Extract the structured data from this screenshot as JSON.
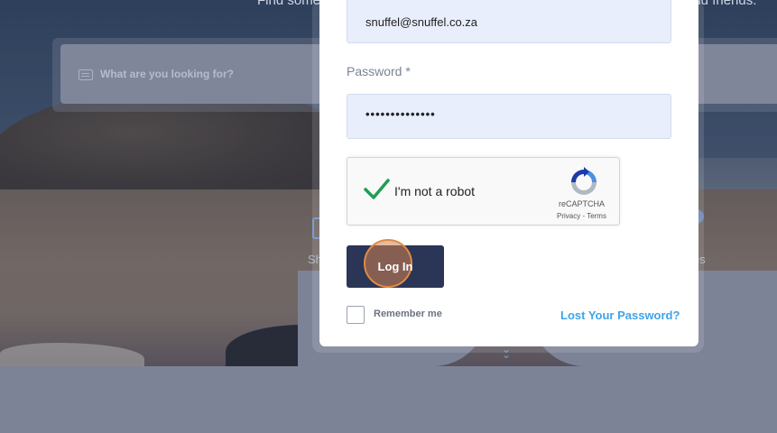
{
  "background": {
    "hero_text_left": "Find some",
    "hero_text_right": "and friends.",
    "search_placeholder": "What are you looking for?",
    "category_left": "Sh",
    "category_right": "es"
  },
  "login_form": {
    "email_value": "snuffel@snuffel.co.za",
    "password_label": "Password *",
    "password_value": "••••••••••••••",
    "recaptcha": {
      "label": "I'm not a robot",
      "brand": "reCAPTCHA",
      "links": "Privacy - Terms"
    },
    "login_button": "Log In",
    "remember_me": "Remember me",
    "lost_password": "Lost Your Password?"
  },
  "colors": {
    "primary_button": "#2b3556",
    "link": "#3ea4e8",
    "input_bg": "#e8eefb",
    "check_green": "#1f9d55"
  }
}
